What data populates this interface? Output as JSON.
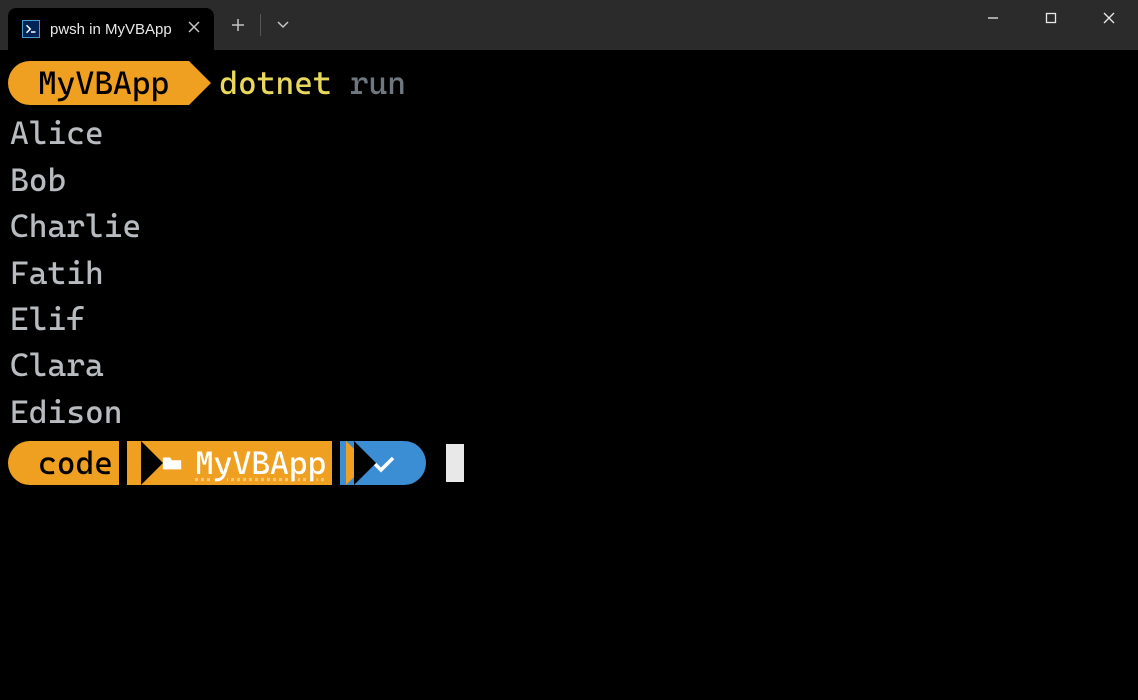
{
  "tab": {
    "title": "pwsh in MyVBApp"
  },
  "prompt1": {
    "dir": "MyVBApp",
    "command": "dotnet",
    "arg": "run"
  },
  "output": [
    "Alice",
    "Bob",
    "Charlie",
    "Fatih",
    "Elif",
    "Clara",
    "Edison"
  ],
  "prompt2": {
    "seg1": "code",
    "seg2": "MyVBApp"
  }
}
